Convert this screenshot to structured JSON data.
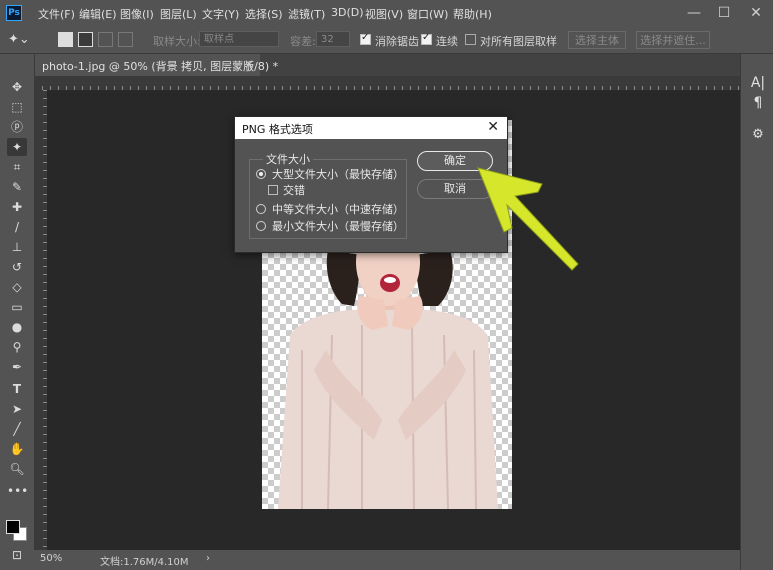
{
  "app": {
    "logo": "Ps"
  },
  "menu": [
    "文件(F)",
    "编辑(E)",
    "图像(I)",
    "图层(L)",
    "文字(Y)",
    "选择(S)",
    "滤镜(T)",
    "3D(D)",
    "视图(V)",
    "窗口(W)",
    "帮助(H)"
  ],
  "window_controls": {
    "minimize": "—",
    "maximize": "☐",
    "close": "✕"
  },
  "options": {
    "sample_size_label": "取样大小:",
    "sample_size_value": "取样点",
    "tolerance_label": "容差:",
    "tolerance_value": "32",
    "antialias_label": "消除锯齿",
    "contiguous_label": "连续",
    "all_layers_label": "对所有图层取样",
    "select_subject": "选择主体",
    "select_and_mask": "选择并遮住..."
  },
  "document": {
    "tab_label": "photo-1.jpg @ 50% (背景 拷贝, 图层蒙版/8) *",
    "tab_close": "×"
  },
  "status": {
    "zoom": "50%",
    "doc_size": "文档:1.76M/4.10M",
    "arrow": "›"
  },
  "dialog": {
    "title": "PNG 格式选项",
    "close": "✕",
    "group_label": "文件大小",
    "options": [
      "大型文件大小（最快存储）",
      "中等文件大小（中速存储）",
      "最小文件大小（最慢存储）"
    ],
    "selected_index": 0,
    "interlace_label": "交错",
    "interlace_checked": false,
    "ok": "确定",
    "cancel": "取消"
  },
  "right_panel": {
    "char_icon": "A|",
    "para_icon": "¶"
  },
  "colors": {
    "accent_arrow": "#d6e62b",
    "ps_blue": "#31a8ff"
  }
}
